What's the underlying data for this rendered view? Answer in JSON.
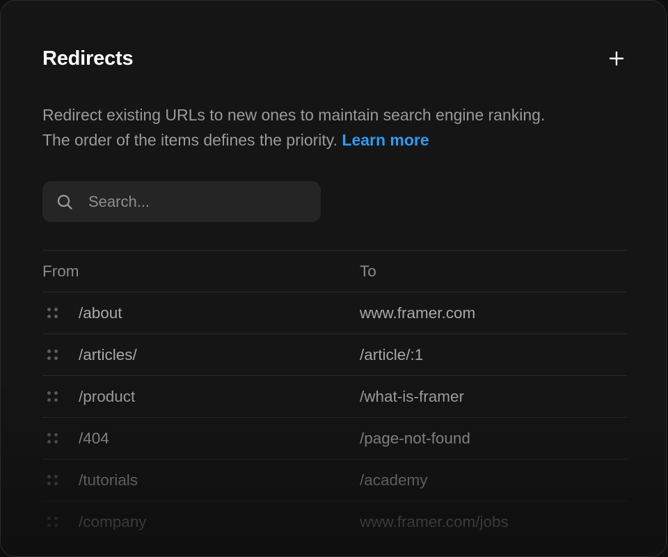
{
  "panel": {
    "title": "Redirects",
    "add_icon": "plus-icon",
    "description": "Redirect existing URLs to new ones to maintain search engine ranking. The order of the items defines the priority.",
    "learn_more": "Learn more"
  },
  "search": {
    "icon": "search-icon",
    "placeholder": "Search..."
  },
  "table": {
    "columns": [
      "From",
      "To"
    ],
    "rows": [
      {
        "from": "/about",
        "to": "www.framer.com"
      },
      {
        "from": "/articles/",
        "to": "/article/:1"
      },
      {
        "from": "/product",
        "to": "/what-is-framer"
      },
      {
        "from": "/404",
        "to": "/page-not-found"
      },
      {
        "from": "/tutorials",
        "to": "/academy"
      },
      {
        "from": "/company",
        "to": "www.framer.com/jobs"
      }
    ],
    "drag_icon": "drag-handle-icon"
  },
  "colors": {
    "background": "#151515",
    "accent": "#2f9bf2",
    "search_bg": "#252525"
  }
}
